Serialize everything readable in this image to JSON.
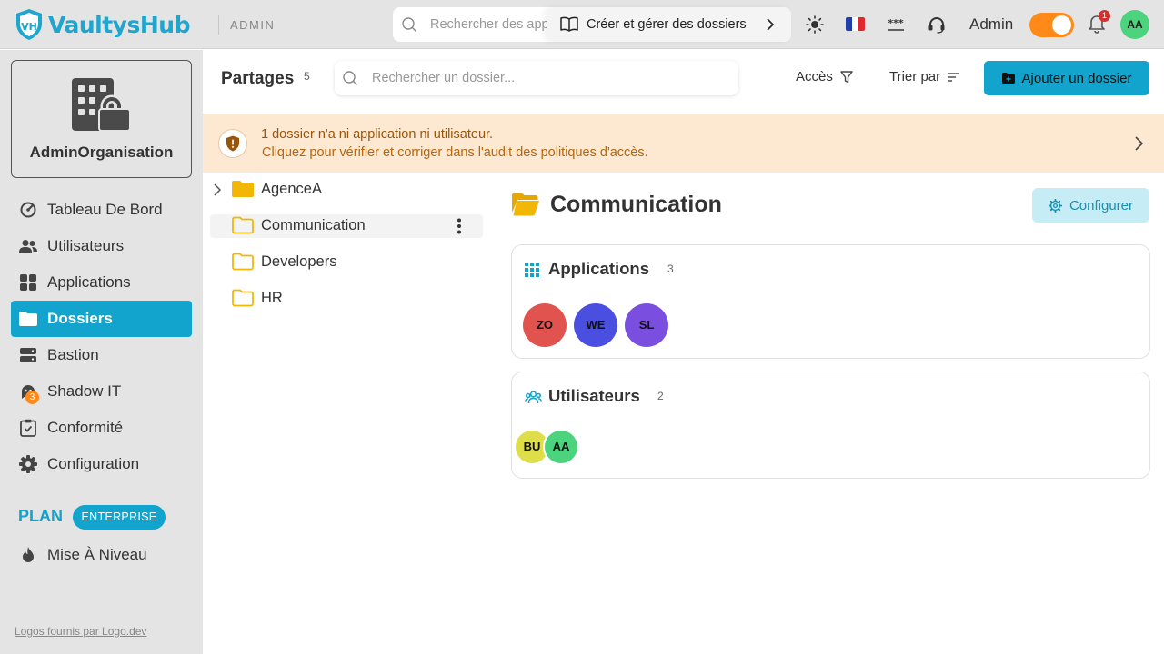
{
  "app": {
    "logo_text": "VaultysHub",
    "section_label": "ADMIN",
    "search_placeholder": "Rechercher des applications",
    "guide_label": "Créer et gérer des dossiers",
    "user_label": "Admin",
    "user_initials": "AA",
    "notification_count": "1",
    "toggle_on": true
  },
  "sidebar": {
    "org_name": "AdminOrganisation",
    "items": [
      {
        "label": "Tableau De Bord",
        "icon": "gauge-icon"
      },
      {
        "label": "Utilisateurs",
        "icon": "users-icon"
      },
      {
        "label": "Applications",
        "icon": "grid-icon"
      },
      {
        "label": "Dossiers",
        "icon": "folder-icon",
        "active": true
      },
      {
        "label": "Bastion",
        "icon": "server-icon"
      },
      {
        "label": "Shadow IT",
        "icon": "ghost-icon",
        "badge": "3"
      },
      {
        "label": "Conformité",
        "icon": "clipboard-check-icon"
      },
      {
        "label": "Configuration",
        "icon": "gear-icon"
      }
    ],
    "plan_label": "PLAN",
    "plan_name": "ENTERPRISE",
    "upgrade_label": "Mise À Niveau",
    "footer_link": "Logos fournis par Logo.dev"
  },
  "header": {
    "title": "Partages",
    "count": "5",
    "search_placeholder": "Rechercher un dossier...",
    "access_label": "Accès",
    "sort_label": "Trier par",
    "add_button_label": "Ajouter un dossier"
  },
  "alert": {
    "line1": "1 dossier n'a ni application ni utilisateur.",
    "line2": "Cliquez pour vérifier et corriger dans l'audit des politiques d'accès."
  },
  "tree": [
    {
      "label": "AgenceA",
      "expandable": true
    },
    {
      "label": "Communication",
      "selected": true
    },
    {
      "label": "Developers"
    },
    {
      "label": "HR"
    }
  ],
  "detail": {
    "title": "Communication",
    "configure_label": "Configurer",
    "applications": {
      "title": "Applications",
      "count": "3",
      "items": [
        {
          "initials": "ZO",
          "color": "#e0534f"
        },
        {
          "initials": "WE",
          "color": "#4a4fe0"
        },
        {
          "initials": "SL",
          "color": "#7a4fe0"
        }
      ]
    },
    "users": {
      "title": "Utilisateurs",
      "count": "2",
      "items": [
        {
          "initials": "BU",
          "color": "#dede4a"
        },
        {
          "initials": "AA",
          "color": "#4cd37e"
        }
      ]
    }
  },
  "colors": {
    "accent": "#12a4cc",
    "orange": "#ff8a1a",
    "folder": "#f2b705",
    "alert_bg": "#fde8d1"
  }
}
